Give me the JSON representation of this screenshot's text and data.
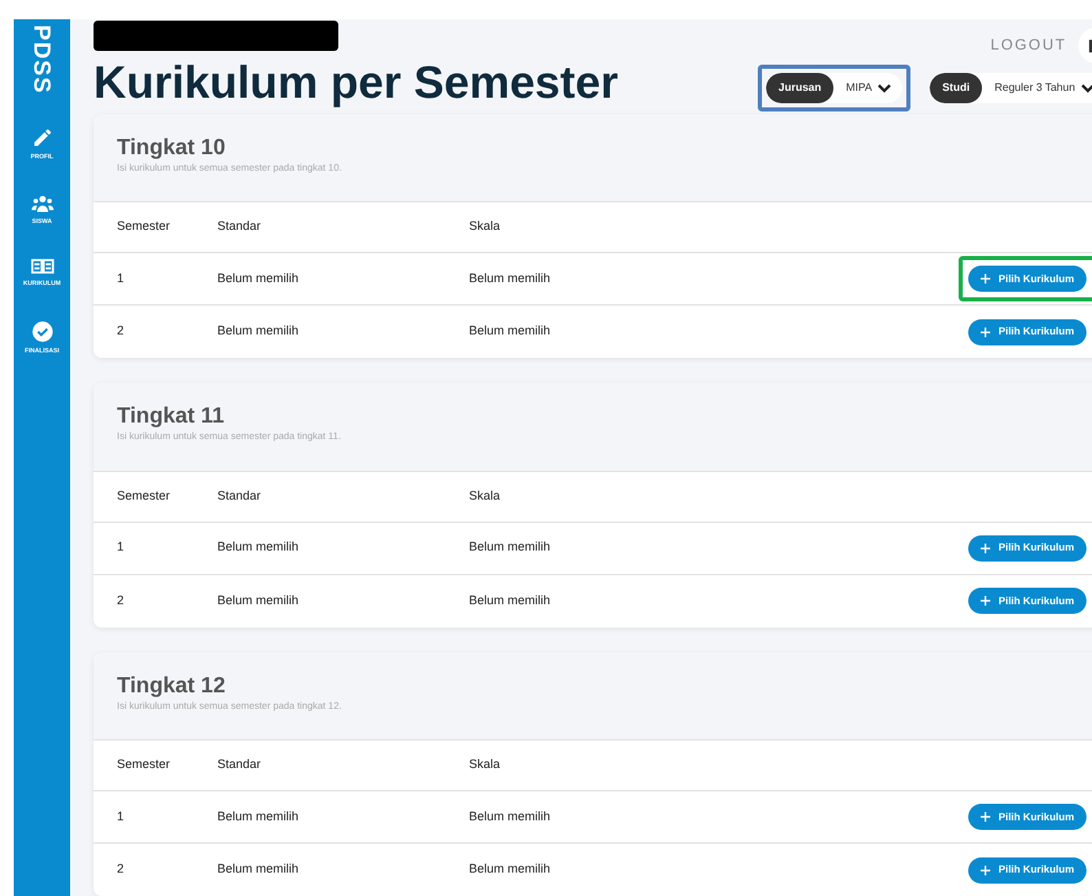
{
  "sidebar": {
    "brand": "PDSS",
    "items": [
      {
        "label": "PROFIL",
        "kind": "pencil"
      },
      {
        "label": "SISWA",
        "kind": "users"
      },
      {
        "label": "KURIKULUM",
        "kind": "book"
      },
      {
        "label": "FINALISASI",
        "kind": "check"
      }
    ]
  },
  "header": {
    "title": "Kurikulum per Semester",
    "logout": "LOGOUT"
  },
  "filters": [
    {
      "label": "Jurusan",
      "value": "MIPA",
      "highlighted": true
    },
    {
      "label": "Studi",
      "value": "Reguler 3 Tahun",
      "highlighted": false
    }
  ],
  "sections": [
    {
      "title": "Tingkat 10",
      "subtitle": "Isi kurikulum untuk semua semester pada tingkat 10.",
      "columns": [
        "Semester",
        "Standar",
        "Skala"
      ],
      "rows": [
        {
          "semester": "1",
          "standar": "Belum memilih",
          "skala": "Belum memilih",
          "action": "Pilih Kurikulum",
          "highlighted": true
        },
        {
          "semester": "2",
          "standar": "Belum memilih",
          "skala": "Belum memilih",
          "action": "Pilih Kurikulum",
          "highlighted": false
        }
      ]
    },
    {
      "title": "Tingkat 11",
      "subtitle": "Isi kurikulum untuk semua semester pada tingkat 11.",
      "columns": [
        "Semester",
        "Standar",
        "Skala"
      ],
      "rows": [
        {
          "semester": "1",
          "standar": "Belum memilih",
          "skala": "Belum memilih",
          "action": "Pilih Kurikulum",
          "highlighted": false
        },
        {
          "semester": "2",
          "standar": "Belum memilih",
          "skala": "Belum memilih",
          "action": "Pilih Kurikulum",
          "highlighted": false
        }
      ]
    },
    {
      "title": "Tingkat 12",
      "subtitle": "Isi kurikulum untuk semua semester pada tingkat 12.",
      "columns": [
        "Semester",
        "Standar",
        "Skala"
      ],
      "rows": [
        {
          "semester": "1",
          "standar": "Belum memilih",
          "skala": "Belum memilih",
          "action": "Pilih Kurikulum",
          "highlighted": false
        },
        {
          "semester": "2",
          "standar": "Belum memilih",
          "skala": "Belum memilih",
          "action": "Pilih Kurikulum",
          "highlighted": false
        }
      ]
    }
  ]
}
